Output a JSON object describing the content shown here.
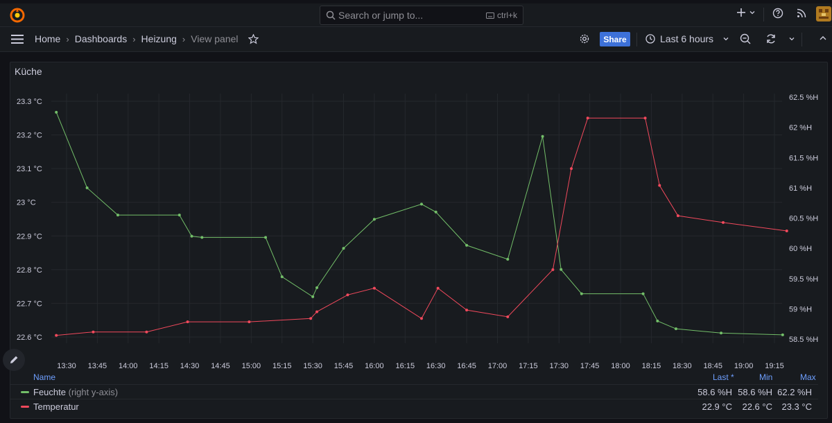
{
  "search": {
    "placeholder": "Search or jump to...",
    "shortcut": "ctrl+k"
  },
  "breadcrumb": {
    "home": "Home",
    "dashboards": "Dashboards",
    "dashboard": "Heizung",
    "current": "View panel"
  },
  "toolbar": {
    "share_label": "Share",
    "time_range": "Last 6 hours"
  },
  "panel": {
    "title": "Küche"
  },
  "chart_data": {
    "type": "line",
    "x": [
      "13:25",
      "13:40",
      "14:00",
      "14:30",
      "14:35",
      "14:40",
      "15:10",
      "15:20",
      "15:35",
      "15:37",
      "15:45",
      "16:00",
      "16:20",
      "16:30",
      "16:45",
      "17:00",
      "17:20",
      "17:25",
      "17:30",
      "17:40",
      "18:05",
      "18:10",
      "18:15",
      "18:30",
      "18:50",
      "19:20"
    ],
    "x_ticks": [
      "13:30",
      "13:45",
      "14:00",
      "14:15",
      "14:30",
      "14:45",
      "15:00",
      "15:15",
      "15:30",
      "15:45",
      "16:00",
      "16:15",
      "16:30",
      "16:45",
      "17:00",
      "17:15",
      "17:30",
      "17:45",
      "18:00",
      "18:15",
      "18:30",
      "18:45",
      "19:00",
      "19:15"
    ],
    "y_left_ticks": [
      "23.3 °C",
      "23.2 °C",
      "23.1 °C",
      "23 °C",
      "22.9 °C",
      "22.8 °C",
      "22.7 °C",
      "22.6 °C"
    ],
    "y_right_ticks": [
      "62.5 %H",
      "62 %H",
      "61.5 %H",
      "61 %H",
      "60.5 %H",
      "60 %H",
      "59.5 %H",
      "59 %H",
      "58.5 %H"
    ],
    "ylim_left": [
      22.6,
      23.3
    ],
    "ylim_right": [
      58.5,
      62.5
    ],
    "grid": true,
    "series": [
      {
        "name": "Feuchte",
        "axis": "right",
        "color": "#73bf69",
        "points": [
          [
            "13:25",
            62.25
          ],
          [
            "13:40",
            61.0
          ],
          [
            "13:55",
            60.55
          ],
          [
            "14:25",
            60.55
          ],
          [
            "14:31",
            60.2
          ],
          [
            "14:36",
            60.18
          ],
          [
            "15:07",
            60.18
          ],
          [
            "15:15",
            59.53
          ],
          [
            "15:30",
            59.2
          ],
          [
            "15:32",
            59.35
          ],
          [
            "15:45",
            60.0
          ],
          [
            "16:00",
            60.48
          ],
          [
            "16:23",
            60.73
          ],
          [
            "16:30",
            60.6
          ],
          [
            "16:45",
            60.05
          ],
          [
            "17:05",
            59.82
          ],
          [
            "17:22",
            61.85
          ],
          [
            "17:31",
            59.65
          ],
          [
            "17:41",
            59.25
          ],
          [
            "18:11",
            59.25
          ],
          [
            "18:18",
            58.8
          ],
          [
            "18:27",
            58.67
          ],
          [
            "18:49",
            58.6
          ],
          [
            "19:19",
            58.57
          ]
        ]
      },
      {
        "name": "Temperatur",
        "axis": "left",
        "color": "#f2495c",
        "points": [
          [
            "13:25",
            22.605
          ],
          [
            "13:43",
            22.615
          ],
          [
            "14:09",
            22.615
          ],
          [
            "14:29",
            22.645
          ],
          [
            "14:59",
            22.645
          ],
          [
            "15:29",
            22.655
          ],
          [
            "15:32",
            22.675
          ],
          [
            "15:47",
            22.725
          ],
          [
            "16:00",
            22.745
          ],
          [
            "16:23",
            22.655
          ],
          [
            "16:31",
            22.745
          ],
          [
            "16:45",
            22.68
          ],
          [
            "17:05",
            22.66
          ],
          [
            "17:27",
            22.8
          ],
          [
            "17:36",
            23.1
          ],
          [
            "17:44",
            23.25
          ],
          [
            "18:12",
            23.25
          ],
          [
            "18:19",
            23.05
          ],
          [
            "18:28",
            22.96
          ],
          [
            "18:50",
            22.94
          ],
          [
            "19:21",
            22.915
          ]
        ]
      }
    ]
  },
  "legend": {
    "header": {
      "name": "Name",
      "last": "Last *",
      "min": "Min",
      "max": "Max"
    },
    "rows": [
      {
        "name": "Feuchte",
        "suffix": "(right y-axis)",
        "color": "#73bf69",
        "last": "58.6 %H",
        "min": "58.6 %H",
        "max": "62.2 %H"
      },
      {
        "name": "Temperatur",
        "suffix": "",
        "color": "#f2495c",
        "last": "22.9 °C",
        "min": "22.6 °C",
        "max": "23.3 °C"
      }
    ]
  }
}
